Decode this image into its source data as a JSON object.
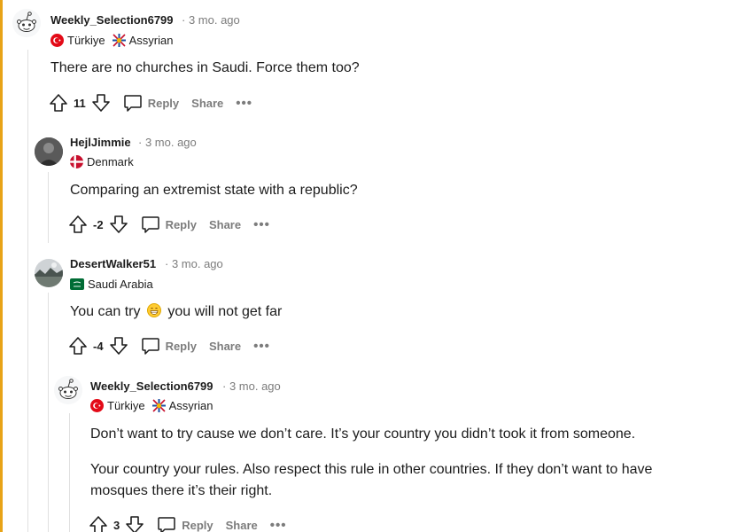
{
  "comments": [
    {
      "username": "Weekly_Selection6799",
      "time": "· 3 mo. ago",
      "flair_country": "Türkiye",
      "flair_extra": "Assyrian",
      "body": [
        "There are no churches in Saudi. Force them too?"
      ],
      "votes": "11",
      "reply": "Reply",
      "share": "Share",
      "more": "•••"
    },
    {
      "username": "HejlJimmie",
      "time": "· 3 mo. ago",
      "flair_country": "Denmark",
      "body": [
        "Comparing an extremist state with a republic?"
      ],
      "votes": "-2",
      "reply": "Reply",
      "share": "Share",
      "more": "•••"
    },
    {
      "username": "DesertWalker51",
      "time": "· 3 mo. ago",
      "flair_country": "Saudi Arabia",
      "body_before_emoji": "You can try",
      "body_after_emoji": "you will not get far",
      "votes": "-4",
      "reply": "Reply",
      "share": "Share",
      "more": "•••"
    },
    {
      "username": "Weekly_Selection6799",
      "time": "· 3 mo. ago",
      "flair_country": "Türkiye",
      "flair_extra": "Assyrian",
      "body": [
        "Don’t want to try cause we don’t care. It’s your country you didn’t took it from someone.",
        "Your country your rules. Also respect this rule in other countries. If they don’t want to have",
        "mosques there it’s their right."
      ],
      "votes": "3",
      "reply": "Reply",
      "share": "Share",
      "more": "•••"
    }
  ],
  "icons": {
    "upvote": "upvote-arrow-icon",
    "downvote": "downvote-arrow-icon",
    "reply": "speech-bubble-icon",
    "avatar_default": "snoo-icon",
    "flag_turkey": "turkey-flag-icon",
    "flag_denmark": "denmark-flag-icon",
    "flag_saudi": "saudi-flag-icon",
    "assyrian": "assyrian-flag-icon",
    "emoji": "grinning-face-icon"
  },
  "colors": {
    "accent_bar": "#e8a317",
    "meta_text": "#7c7c7c",
    "thread_line": "#e0e0e0"
  }
}
